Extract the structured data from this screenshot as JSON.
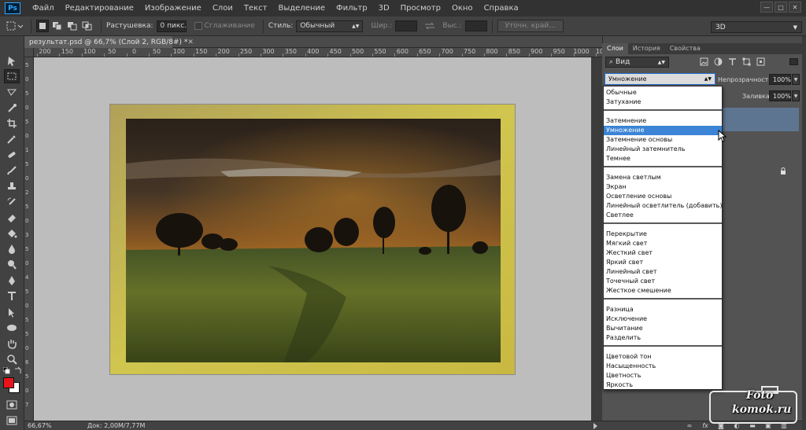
{
  "app": {
    "logo": "Ps"
  },
  "menu": [
    "Файл",
    "Редактирование",
    "Изображение",
    "Слои",
    "Текст",
    "Выделение",
    "Фильтр",
    "3D",
    "Просмотр",
    "Окно",
    "Справка"
  ],
  "window_controls": [
    "—",
    "□",
    "✕"
  ],
  "options": {
    "feather_label": "Растушевка:",
    "feather_value": "0 пикс.",
    "antialias_label": "Сглаживание",
    "style_label": "Стиль:",
    "style_value": "Обычный",
    "width_label": "Шир.:",
    "height_label": "Выс.:",
    "refine_edge_label": "Уточн. край..."
  },
  "workspace": {
    "value": "3D"
  },
  "document": {
    "tab_title": "результат.psd @ 66,7% (Слой 2, RGB/8#) *",
    "zoom": "66,67%",
    "doc_size": "Док: 2,00M/7,77M"
  },
  "ruler": {
    "h_labels": [
      "200",
      "150",
      "100",
      "50",
      "0",
      "50",
      "100",
      "150",
      "200",
      "250",
      "300",
      "350",
      "400",
      "450",
      "500",
      "550",
      "600",
      "650",
      "700",
      "750",
      "800",
      "850",
      "900",
      "950",
      "1000",
      "1050"
    ],
    "v_labels": [
      "5",
      "0",
      "5",
      "0",
      "5",
      "0",
      "1",
      "5",
      "0",
      "2",
      "5",
      "0",
      "3",
      "5",
      "0",
      "4",
      "5",
      "0",
      "5",
      "5",
      "0",
      "6",
      "5",
      "0",
      "7"
    ]
  },
  "layers_panel": {
    "tabs": [
      "Слои",
      "История",
      "Свойства"
    ],
    "kind_label": "Вид",
    "blend_value": "Умножение",
    "opacity_label": "Непрозрачность:",
    "opacity_value": "100%",
    "fill_label": "Заливка:",
    "fill_value": "100%"
  },
  "blend_modes": {
    "groups": [
      [
        "Обычные",
        "Затухание"
      ],
      [
        "Затемнение",
        "Умножение",
        "Затемнение основы",
        "Линейный затемнитель",
        "Темнее"
      ],
      [
        "Замена светлым",
        "Экран",
        "Осветление основы",
        "Линейный осветлитель (добавить)",
        "Светлее"
      ],
      [
        "Перекрытие",
        "Мягкий свет",
        "Жесткий свет",
        "Яркий свет",
        "Линейный свет",
        "Точечный свет",
        "Жесткое смешение"
      ],
      [
        "Разница",
        "Исключение",
        "Вычитание",
        "Разделить"
      ],
      [
        "Цветовой тон",
        "Насыщенность",
        "Цветность",
        "Яркость"
      ]
    ],
    "selected": "Умножение"
  },
  "colors": {
    "foreground": "#e8141b",
    "background": "#ffffff",
    "selection": "#3b84d6"
  },
  "watermark": {
    "line1": "Foto",
    "line2": "komok.ru"
  },
  "icons": {
    "tools": [
      "move-icon",
      "marquee-icon",
      "lasso-icon",
      "quick-select-icon",
      "crop-icon",
      "eyedropper-icon",
      "healing-brush-icon",
      "brush-icon",
      "clone-stamp-icon",
      "history-brush-icon",
      "eraser-icon",
      "paint-bucket-icon",
      "blur-icon",
      "dodge-icon",
      "pen-icon",
      "type-icon",
      "path-select-icon",
      "ellipse-icon",
      "hand-icon",
      "zoom-icon"
    ],
    "layer_filters": [
      "image-filter-icon",
      "adjustment-filter-icon",
      "type-filter-icon",
      "shape-filter-icon",
      "smart-object-filter-icon"
    ],
    "footer": [
      "link-icon",
      "fx-icon",
      "mask-icon",
      "adjustment-icon",
      "folder-icon",
      "new-layer-icon",
      "trash-icon"
    ]
  }
}
